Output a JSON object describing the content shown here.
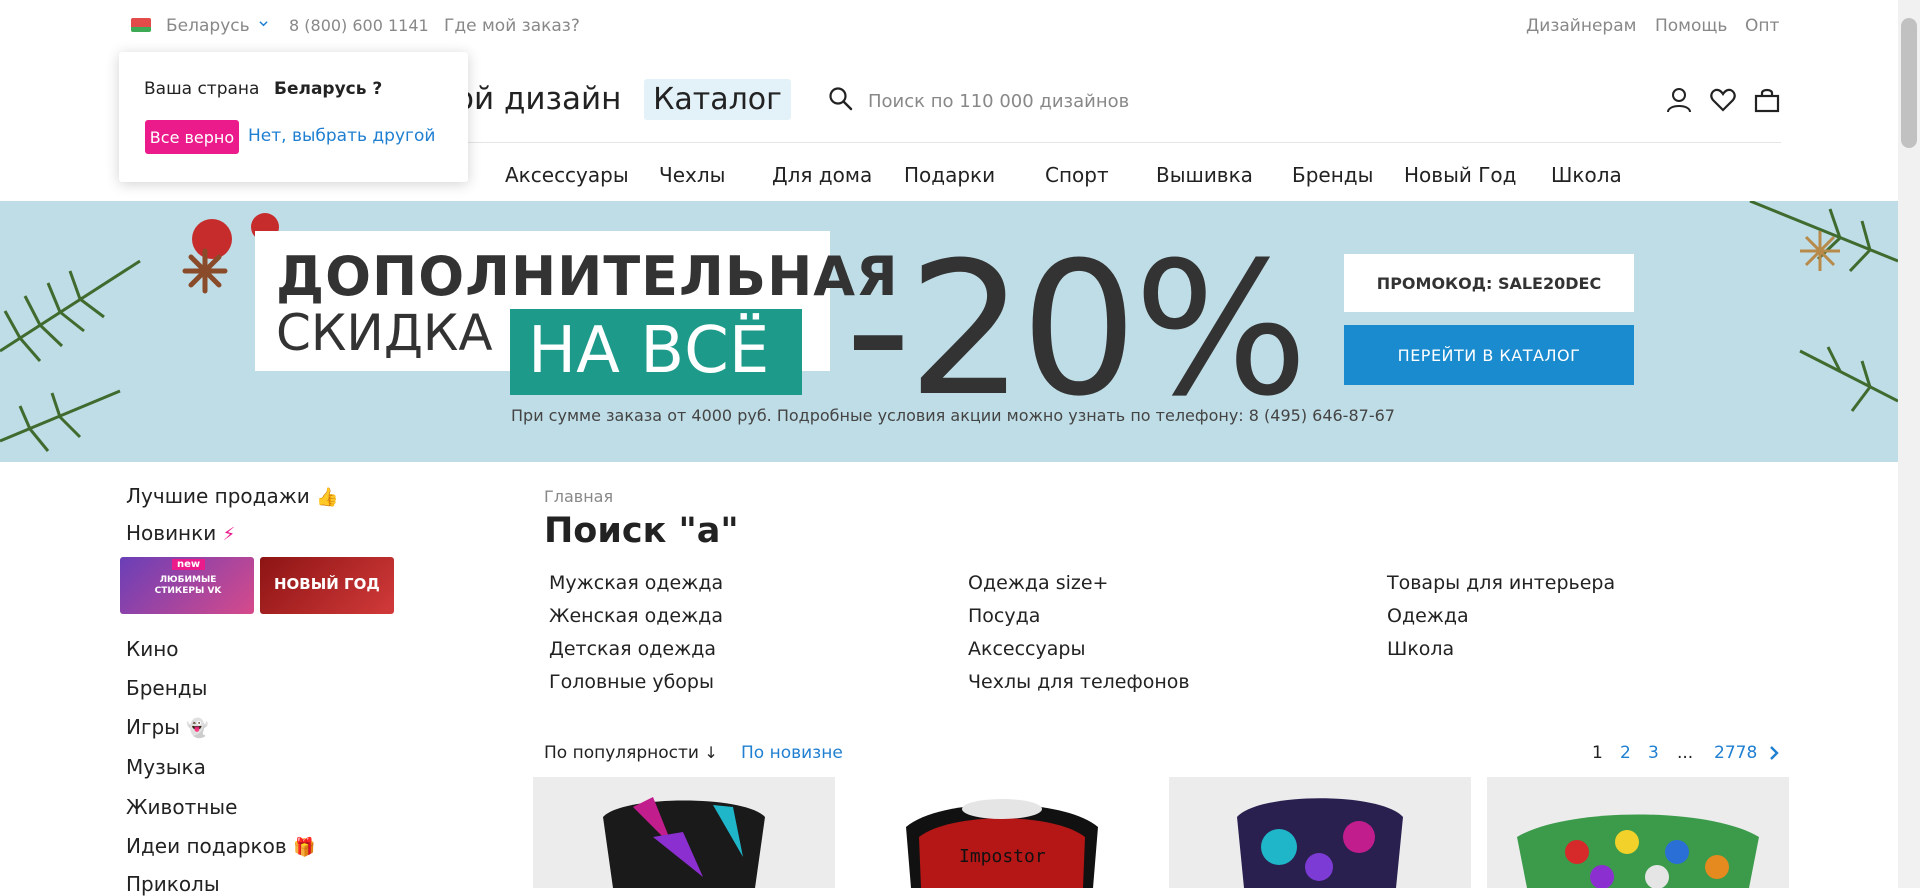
{
  "topbar": {
    "country": "Беларусь",
    "phone": "8 (800) 600 1141",
    "order": "Где мой заказ?",
    "designers": "Дизайнерам",
    "help": "Помощь",
    "wholesale": "Опт"
  },
  "popup": {
    "question": "Ваша страна",
    "country": "Беларусь ?",
    "confirm": "Все верно",
    "other": "Нет, выбрать другой"
  },
  "header": {
    "logo_fragment": "ой дизайн",
    "catalog": "Каталог",
    "search_placeholder": "Поиск по 110 000 дизайнов"
  },
  "nav": [
    "Аксессуары",
    "Чехлы",
    "Для дома",
    "Подарки",
    "Спорт",
    "Вышивка",
    "Бренды",
    "Новый Год",
    "Школа"
  ],
  "banner": {
    "line1": "ДОПОЛНИТЕЛЬНАЯ",
    "line2": "СКИДКА",
    "line3": "НА ВСЁ",
    "discount": "-20%",
    "note": "При сумме заказа от 4000 руб. Подробные условия акции можно узнать по телефону: 8 (495) 646-87-67",
    "promo": "ПРОМОКОД: SALE20DEC",
    "go_catalog": "ПЕРЕЙТИ В КАТАЛОГ"
  },
  "sidebar": {
    "best": "Лучшие продажи",
    "new": "Новинки",
    "thumb1_badge": "new",
    "thumb1_text": "ЛЮБИМЫЕ СТИКЕРЫ VK",
    "thumb2_text": "НОВЫЙ ГОД",
    "items": [
      "Кино",
      "Бренды",
      "Игры",
      "Музыка",
      "Животные",
      "Идеи подарков",
      "Приколы"
    ]
  },
  "main": {
    "breadcrumb": "Главная",
    "title": "Поиск \"а\"",
    "categories": [
      [
        "Мужская одежда",
        "Женская одежда",
        "Детская одежда",
        "Головные уборы"
      ],
      [
        "Одежда size+",
        "Посуда",
        "Аксессуары",
        "Чехлы для телефонов"
      ],
      [
        "Товары для интерьера",
        "Одежда",
        "Школа"
      ]
    ],
    "sort_popular": "По популярности",
    "sort_new": "По новизне",
    "pages": [
      "1",
      "2",
      "3",
      "...",
      "2778"
    ]
  },
  "colors": {
    "accent_pink": "#ec1b8c",
    "link_blue": "#1f7fd1",
    "banner_blue": "#1b8bd0",
    "banner_teal": "#1e9a8a"
  },
  "icons": [
    "search-icon",
    "user-icon",
    "heart-icon",
    "bag-icon",
    "chevron-down-icon",
    "chevron-right-icon",
    "thumbs-up-icon",
    "lightning-icon",
    "ghost-icon",
    "gift-icon"
  ]
}
